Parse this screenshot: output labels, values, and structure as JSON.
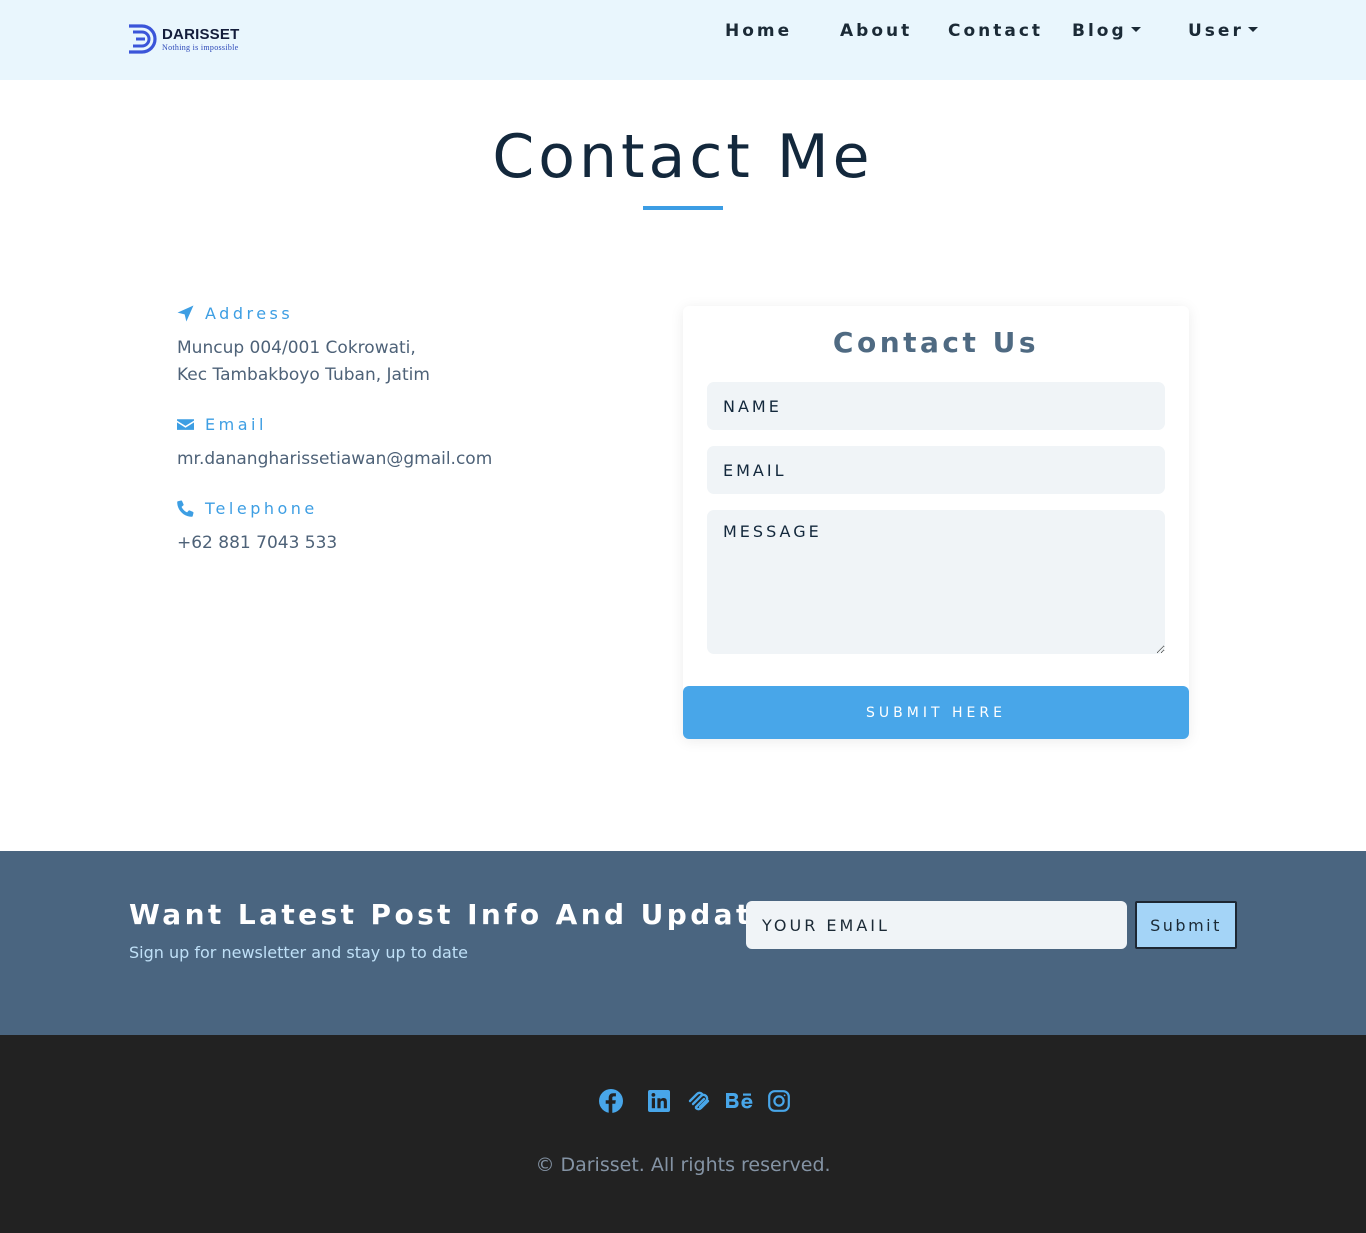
{
  "brand": {
    "name": "DARISSET",
    "tagline": "Nothing  is  impossible"
  },
  "nav": {
    "home": "Home",
    "about": "About",
    "contact": "Contact",
    "blog": "Blog",
    "user": "User"
  },
  "page": {
    "title": "Contact Me"
  },
  "info": {
    "address_label": "Address",
    "address_line1": "Muncup 004/001 Cokrowati,",
    "address_line2": "Kec Tambakboyo Tuban, Jatim",
    "email_label": "Email",
    "email_value": "mr.danangharissetiawan@gmail.com",
    "phone_label": "Telephone",
    "phone_value": "+62 881 7043 533"
  },
  "form": {
    "title": "Contact Us",
    "name_placeholder": "NAME",
    "email_placeholder": "EMAIL",
    "message_placeholder": "MESSAGE",
    "submit_label": "SUBMIT HERE"
  },
  "newsletter": {
    "title": "Want Latest Post Info And Updates?",
    "subtitle": "Sign up for newsletter and stay up to date",
    "email_placeholder": "YOUR EMAIL",
    "submit_label": "Submit"
  },
  "footer": {
    "social_icons": [
      "facebook-icon",
      "linkedin-icon",
      "squarespace-icon",
      "behance-icon",
      "instagram-icon"
    ],
    "copyright": "© Darisset. All rights reserved."
  },
  "colors": {
    "accent": "#48a6e9",
    "nav_bg": "#e9f6fd",
    "newsletter_bg": "#4a6580",
    "footer_bg": "#222222"
  }
}
